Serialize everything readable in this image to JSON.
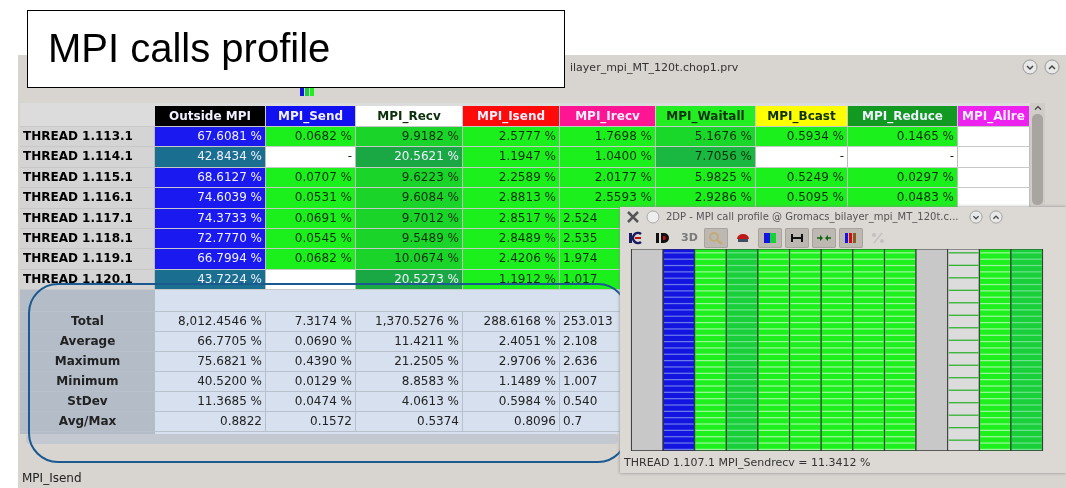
{
  "annotation": {
    "title": "MPI calls profile"
  },
  "main_window": {
    "title": "ilayer_mpi_MT_120t.chop1.prv",
    "columns": [
      {
        "label": "Outside MPI",
        "color": "#000000"
      },
      {
        "label": "MPI_Send",
        "color": "#1010f0"
      },
      {
        "label": "MPI_Recv",
        "color": "#ffffff"
      },
      {
        "label": "MPI_Isend",
        "color": "#ff0a0a"
      },
      {
        "label": "MPI_Irecv",
        "color": "#ff1493"
      },
      {
        "label": "MPI_Waitall",
        "color": "#22ee22"
      },
      {
        "label": "MPI_Bcast",
        "color": "#ffff00"
      },
      {
        "label": "MPI_Reduce",
        "color": "#119922"
      },
      {
        "label": "MPI_Allre",
        "color": "#ee22ee"
      }
    ],
    "rows": [
      {
        "label": "THREAD 1.113.1",
        "cells": [
          {
            "text": "67.6081 %",
            "color": "#1a1af0"
          },
          {
            "text": "0.0682 %",
            "color": "#1cf01c"
          },
          {
            "text": "9.9182 %",
            "color": "#1ad42a"
          },
          {
            "text": "2.5777 %",
            "color": "#1cf01c"
          },
          {
            "text": "1.7698 %",
            "color": "#1cf01c"
          },
          {
            "text": "5.1676 %",
            "color": "#1ad82a"
          },
          {
            "text": "0.5934 %",
            "color": "#1cf01c"
          },
          {
            "text": "0.1465 %",
            "color": "#1cf01c"
          },
          {
            "color": "#ffffff"
          }
        ]
      },
      {
        "label": "THREAD 1.114.1",
        "cells": [
          {
            "text": "42.8434 %",
            "color": "#1a6e90"
          },
          {
            "text": "-",
            "color": "#ffffff"
          },
          {
            "text": "20.5621 %",
            "color": "#1aa844"
          },
          {
            "text": "1.1947 %",
            "color": "#1cf01c"
          },
          {
            "text": "1.0400 %",
            "color": "#1cf01c"
          },
          {
            "text": "7.7056 %",
            "color": "#1ab840"
          },
          {
            "text": "-",
            "color": "#ffffff"
          },
          {
            "text": "-",
            "color": "#ffffff"
          },
          {
            "color": "#ffffff"
          }
        ]
      },
      {
        "label": "THREAD 1.115.1",
        "cells": [
          {
            "text": "68.6127 %",
            "color": "#1a1af0"
          },
          {
            "text": "0.0707 %",
            "color": "#1cf01c"
          },
          {
            "text": "9.6223 %",
            "color": "#1ad42a"
          },
          {
            "text": "2.2589 %",
            "color": "#1cf01c"
          },
          {
            "text": "2.0177 %",
            "color": "#1cf01c"
          },
          {
            "text": "5.9825 %",
            "color": "#1cf01c"
          },
          {
            "text": "0.5249 %",
            "color": "#1cf01c"
          },
          {
            "text": "0.0297 %",
            "color": "#1cf01c"
          },
          {
            "color": "#ffffff"
          }
        ]
      },
      {
        "label": "THREAD 1.116.1",
        "cells": [
          {
            "text": "74.6039 %",
            "color": "#1a1af0"
          },
          {
            "text": "0.0531 %",
            "color": "#1cf01c"
          },
          {
            "text": "9.6084 %",
            "color": "#1ad42a"
          },
          {
            "text": "2.8813 %",
            "color": "#1cf01c"
          },
          {
            "text": "2.5593 %",
            "color": "#1cf01c"
          },
          {
            "text": "2.9286 %",
            "color": "#1cf01c"
          },
          {
            "text": "0.5095 %",
            "color": "#1cf01c"
          },
          {
            "text": "0.0483 %",
            "color": "#1cf01c"
          },
          {
            "color": "#ffffff"
          }
        ]
      },
      {
        "label": "THREAD 1.117.1",
        "cells": [
          {
            "text": "74.3733 %",
            "color": "#1a1af0"
          },
          {
            "text": "0.0691 %",
            "color": "#1cf01c"
          },
          {
            "text": "9.7012 %",
            "color": "#1ad42a"
          },
          {
            "text": "2.8517 %",
            "color": "#1cf01c"
          },
          {
            "text": "2.524",
            "color": "#1cf01c"
          }
        ]
      },
      {
        "label": "THREAD 1.118.1",
        "cells": [
          {
            "text": "72.7770 %",
            "color": "#1a1af0"
          },
          {
            "text": "0.0545 %",
            "color": "#1cf01c"
          },
          {
            "text": "9.5489 %",
            "color": "#1ad42a"
          },
          {
            "text": "2.8489 %",
            "color": "#1cf01c"
          },
          {
            "text": "2.535",
            "color": "#1cf01c"
          }
        ]
      },
      {
        "label": "THREAD 1.119.1",
        "cells": [
          {
            "text": "66.7994 %",
            "color": "#1a1af0"
          },
          {
            "text": "0.0682 %",
            "color": "#1cf01c"
          },
          {
            "text": "10.0674 %",
            "color": "#1ad42a"
          },
          {
            "text": "2.4206 %",
            "color": "#1cf01c"
          },
          {
            "text": "1.974",
            "color": "#1cf01c"
          }
        ]
      },
      {
        "label": "THREAD 1.120.1",
        "cells": [
          {
            "text": "43.7224 %",
            "color": "#1a6e90"
          },
          {
            "color": "#ffffff"
          },
          {
            "text": "20.5273 %",
            "color": "#1aa844"
          },
          {
            "text": "1.1912 %",
            "color": "#1cf01c"
          },
          {
            "text": "1.017",
            "color": "#1cf01c"
          }
        ]
      }
    ],
    "stats": [
      {
        "label": "Total",
        "values": [
          "8,012.4546 %",
          "7.3174 %",
          "1,370.5276 %",
          "288.6168 %",
          "253.013"
        ]
      },
      {
        "label": "Average",
        "values": [
          "66.7705 %",
          "0.0690 %",
          "11.4211 %",
          "2.4051 %",
          "2.108"
        ]
      },
      {
        "label": "Maximum",
        "values": [
          "75.6821 %",
          "0.4390 %",
          "21.2505 %",
          "2.9706 %",
          "2.636"
        ]
      },
      {
        "label": "Minimum",
        "values": [
          "40.5200 %",
          "0.0129 %",
          "8.8583 %",
          "1.1489 %",
          "1.007"
        ]
      },
      {
        "label": "StDev",
        "values": [
          "11.3685 %",
          "0.0474 %",
          "4.0613 %",
          "0.5984 %",
          "0.540"
        ]
      },
      {
        "label": "Avg/Max",
        "values": [
          "0.8822",
          "0.1572",
          "0.5374",
          "0.8096",
          "0.7"
        ]
      }
    ],
    "status_bar": "MPI_Isend"
  },
  "profile_window": {
    "title": "2DP - MPI call profile @ Gromacs_bilayer_mpi_MT_120t.c...",
    "toolbar": [
      {
        "kind": "ie",
        "pressed": false,
        "disabled": false
      },
      {
        "kind": "d",
        "pressed": false,
        "disabled": false
      },
      {
        "kind": "text",
        "label": "3D",
        "pressed": false,
        "disabled": true
      },
      {
        "kind": "zoom",
        "pressed": true,
        "disabled": true
      },
      {
        "kind": "paint",
        "pressed": false,
        "disabled": false
      },
      {
        "kind": "colors",
        "pressed": true,
        "disabled": false
      },
      {
        "kind": "hbar",
        "pressed": true,
        "disabled": false
      },
      {
        "kind": "arrows",
        "pressed": true,
        "disabled": false
      },
      {
        "kind": "bars",
        "pressed": true,
        "disabled": false
      },
      {
        "kind": "percent",
        "pressed": false,
        "disabled": true
      }
    ],
    "status_bar": "THREAD 1.107.1  MPI_Sendrecv = 11.3412 %"
  }
}
